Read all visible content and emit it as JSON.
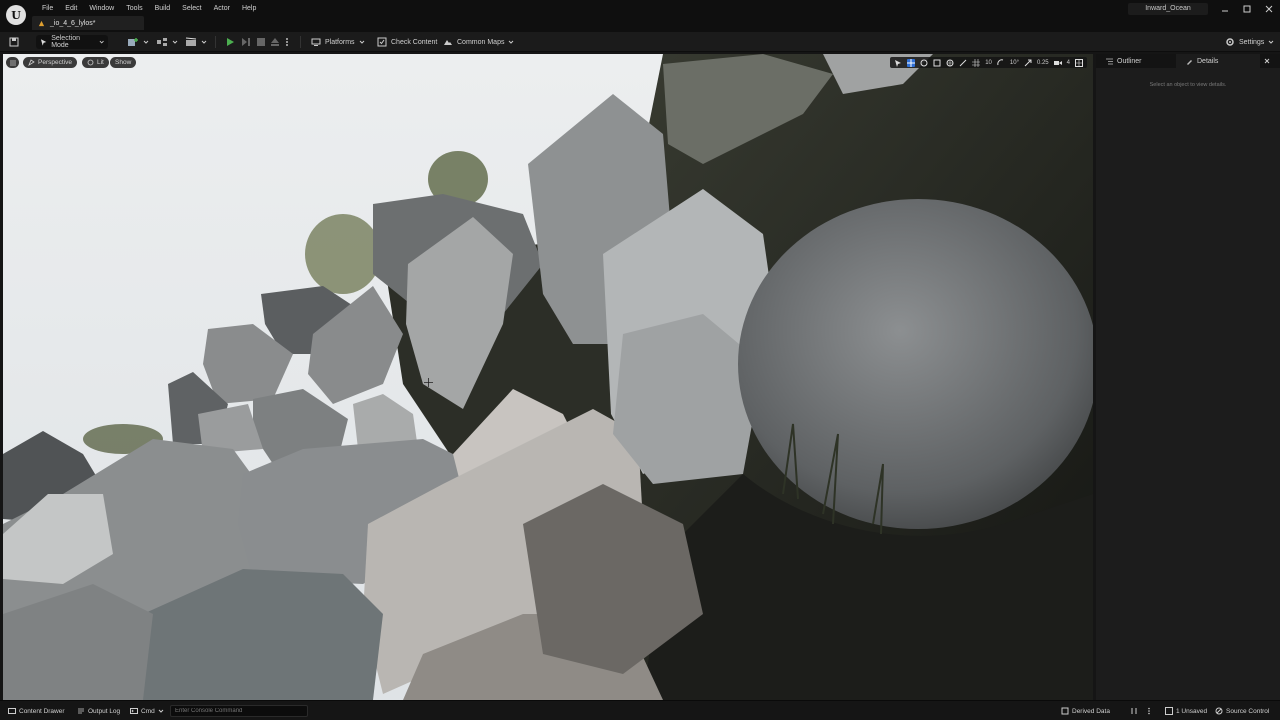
{
  "titlebar": {
    "menu": [
      "File",
      "Edit",
      "Window",
      "Tools",
      "Build",
      "Select",
      "Actor",
      "Help"
    ],
    "doc_tab": "_io_4_6_lylos*",
    "project": "Inward_Ocean"
  },
  "toolbar": {
    "selection_mode": "Selection Mode",
    "platforms": "Platforms",
    "check_content": "Check Content",
    "common_maps": "Common Maps",
    "settings": "Settings"
  },
  "viewport": {
    "perspective": "Perspective",
    "lit": "Lit",
    "show": "Show",
    "grid_snap": "10",
    "rotation_snap": "10°",
    "scale_snap": "0.25",
    "camera_speed": "4"
  },
  "panel": {
    "outliner": "Outliner",
    "details": "Details",
    "hint": "Select an object to view details."
  },
  "statusbar": {
    "content_drawer": "Content Drawer",
    "output_log": "Output Log",
    "cmd": "Cmd",
    "console_placeholder": "Enter Console Command",
    "derived_data": "Derived Data",
    "unsaved": "1 Unsaved",
    "source_control": "Source Control"
  },
  "colors": {
    "play_green": "#4caf50",
    "sky": "#e5e8ea",
    "accent_blue": "#2f6fd6"
  }
}
